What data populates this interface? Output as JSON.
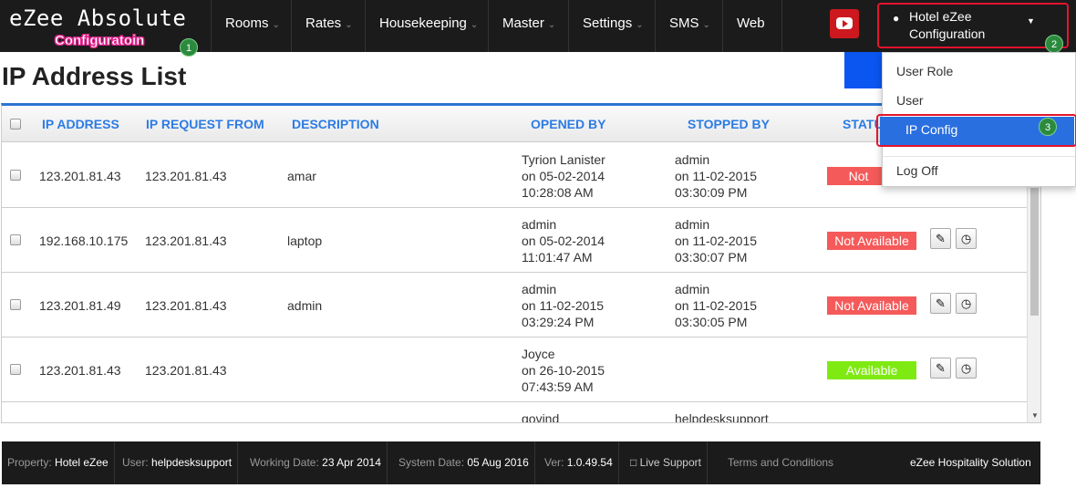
{
  "brand": {
    "title": "eZee Absolute",
    "subtitle": "Configuratoin",
    "badge": "1"
  },
  "nav": [
    {
      "label": "Rooms",
      "caret": "⌄"
    },
    {
      "label": "Rates",
      "caret": "⌄"
    },
    {
      "label": "Housekeeping",
      "caret": "⌄"
    },
    {
      "label": "Master",
      "caret": "⌄"
    },
    {
      "label": "Settings",
      "caret": "⌄"
    },
    {
      "label": "SMS",
      "caret": "⌄"
    },
    {
      "label": "Web",
      "caret": ""
    }
  ],
  "user_menu": {
    "line1": "Hotel eZee",
    "line2": "Configuration",
    "badge": "2"
  },
  "dropdown": {
    "items": [
      "User Role",
      "User",
      "IP Config",
      "Log Off"
    ],
    "active_badge": "3"
  },
  "page": {
    "title": "IP Address List"
  },
  "table": {
    "headers": [
      "IP ADDRESS",
      "IP REQUEST FROM",
      "DESCRIPTION",
      "OPENED BY",
      "STOPPED BY",
      "STATUS"
    ],
    "rows": [
      {
        "ip": "123.201.81.43",
        "request_from": "123.201.81.43",
        "description": "amar",
        "opened_by": "Tyrion Lanister",
        "opened_on": "on 05-02-2014",
        "opened_time": "10:28:08 AM",
        "stopped_by": "admin",
        "stopped_on": "on 11-02-2015",
        "stopped_time": "03:30:09 PM",
        "status": "Not Available"
      },
      {
        "ip": "192.168.10.175",
        "request_from": "123.201.81.43",
        "description": "laptop",
        "opened_by": "admin",
        "opened_on": "on 05-02-2014",
        "opened_time": "11:01:47 AM",
        "stopped_by": "admin",
        "stopped_on": "on 11-02-2015",
        "stopped_time": "03:30:07 PM",
        "status": "Not Available"
      },
      {
        "ip": "123.201.81.49",
        "request_from": "123.201.81.43",
        "description": "admin",
        "opened_by": "admin",
        "opened_on": "on 11-02-2015",
        "opened_time": "03:29:24 PM",
        "stopped_by": "admin",
        "stopped_on": "on 11-02-2015",
        "stopped_time": "03:30:05 PM",
        "status": "Not Available"
      },
      {
        "ip": "123.201.81.43",
        "request_from": "123.201.81.43",
        "description": "",
        "opened_by": "Joyce",
        "opened_on": "on 26-10-2015",
        "opened_time": "07:43:59 AM",
        "stopped_by": "",
        "stopped_on": "",
        "stopped_time": "",
        "status": "Available"
      },
      {
        "ip": "",
        "request_from": "",
        "description": "",
        "opened_by": "govind",
        "opened_on": "",
        "opened_time": "",
        "stopped_by": "helpdesksupport",
        "stopped_on": "",
        "stopped_time": "",
        "status": ""
      }
    ]
  },
  "footer": {
    "property_label": "Property:",
    "property_value": "Hotel eZee",
    "user_label": "User:",
    "user_value": "helpdesksupport",
    "working_label": "Working Date:",
    "working_value": "23 Apr 2014",
    "system_label": "System Date:",
    "system_value": "05 Aug 2016",
    "ver_label": "Ver:",
    "ver_value": "1.0.49.54",
    "live_support": "Live Support",
    "terms": "Terms and Conditions",
    "company": "eZee Hospitality Solution"
  }
}
